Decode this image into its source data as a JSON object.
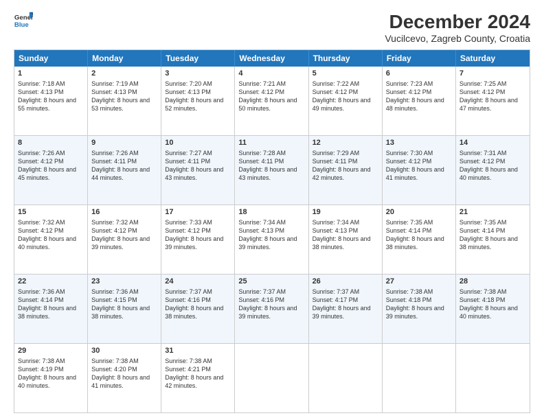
{
  "logo": {
    "line1": "General",
    "line2": "Blue"
  },
  "title": "December 2024",
  "subtitle": "Vucilcevo, Zagreb County, Croatia",
  "weekdays": [
    "Sunday",
    "Monday",
    "Tuesday",
    "Wednesday",
    "Thursday",
    "Friday",
    "Saturday"
  ],
  "weeks": [
    [
      {
        "day": "1",
        "sunrise": "Sunrise: 7:18 AM",
        "sunset": "Sunset: 4:13 PM",
        "daylight": "Daylight: 8 hours and 55 minutes."
      },
      {
        "day": "2",
        "sunrise": "Sunrise: 7:19 AM",
        "sunset": "Sunset: 4:13 PM",
        "daylight": "Daylight: 8 hours and 53 minutes."
      },
      {
        "day": "3",
        "sunrise": "Sunrise: 7:20 AM",
        "sunset": "Sunset: 4:13 PM",
        "daylight": "Daylight: 8 hours and 52 minutes."
      },
      {
        "day": "4",
        "sunrise": "Sunrise: 7:21 AM",
        "sunset": "Sunset: 4:12 PM",
        "daylight": "Daylight: 8 hours and 50 minutes."
      },
      {
        "day": "5",
        "sunrise": "Sunrise: 7:22 AM",
        "sunset": "Sunset: 4:12 PM",
        "daylight": "Daylight: 8 hours and 49 minutes."
      },
      {
        "day": "6",
        "sunrise": "Sunrise: 7:23 AM",
        "sunset": "Sunset: 4:12 PM",
        "daylight": "Daylight: 8 hours and 48 minutes."
      },
      {
        "day": "7",
        "sunrise": "Sunrise: 7:25 AM",
        "sunset": "Sunset: 4:12 PM",
        "daylight": "Daylight: 8 hours and 47 minutes."
      }
    ],
    [
      {
        "day": "8",
        "sunrise": "Sunrise: 7:26 AM",
        "sunset": "Sunset: 4:12 PM",
        "daylight": "Daylight: 8 hours and 45 minutes."
      },
      {
        "day": "9",
        "sunrise": "Sunrise: 7:26 AM",
        "sunset": "Sunset: 4:11 PM",
        "daylight": "Daylight: 8 hours and 44 minutes."
      },
      {
        "day": "10",
        "sunrise": "Sunrise: 7:27 AM",
        "sunset": "Sunset: 4:11 PM",
        "daylight": "Daylight: 8 hours and 43 minutes."
      },
      {
        "day": "11",
        "sunrise": "Sunrise: 7:28 AM",
        "sunset": "Sunset: 4:11 PM",
        "daylight": "Daylight: 8 hours and 43 minutes."
      },
      {
        "day": "12",
        "sunrise": "Sunrise: 7:29 AM",
        "sunset": "Sunset: 4:11 PM",
        "daylight": "Daylight: 8 hours and 42 minutes."
      },
      {
        "day": "13",
        "sunrise": "Sunrise: 7:30 AM",
        "sunset": "Sunset: 4:12 PM",
        "daylight": "Daylight: 8 hours and 41 minutes."
      },
      {
        "day": "14",
        "sunrise": "Sunrise: 7:31 AM",
        "sunset": "Sunset: 4:12 PM",
        "daylight": "Daylight: 8 hours and 40 minutes."
      }
    ],
    [
      {
        "day": "15",
        "sunrise": "Sunrise: 7:32 AM",
        "sunset": "Sunset: 4:12 PM",
        "daylight": "Daylight: 8 hours and 40 minutes."
      },
      {
        "day": "16",
        "sunrise": "Sunrise: 7:32 AM",
        "sunset": "Sunset: 4:12 PM",
        "daylight": "Daylight: 8 hours and 39 minutes."
      },
      {
        "day": "17",
        "sunrise": "Sunrise: 7:33 AM",
        "sunset": "Sunset: 4:12 PM",
        "daylight": "Daylight: 8 hours and 39 minutes."
      },
      {
        "day": "18",
        "sunrise": "Sunrise: 7:34 AM",
        "sunset": "Sunset: 4:13 PM",
        "daylight": "Daylight: 8 hours and 39 minutes."
      },
      {
        "day": "19",
        "sunrise": "Sunrise: 7:34 AM",
        "sunset": "Sunset: 4:13 PM",
        "daylight": "Daylight: 8 hours and 38 minutes."
      },
      {
        "day": "20",
        "sunrise": "Sunrise: 7:35 AM",
        "sunset": "Sunset: 4:14 PM",
        "daylight": "Daylight: 8 hours and 38 minutes."
      },
      {
        "day": "21",
        "sunrise": "Sunrise: 7:35 AM",
        "sunset": "Sunset: 4:14 PM",
        "daylight": "Daylight: 8 hours and 38 minutes."
      }
    ],
    [
      {
        "day": "22",
        "sunrise": "Sunrise: 7:36 AM",
        "sunset": "Sunset: 4:14 PM",
        "daylight": "Daylight: 8 hours and 38 minutes."
      },
      {
        "day": "23",
        "sunrise": "Sunrise: 7:36 AM",
        "sunset": "Sunset: 4:15 PM",
        "daylight": "Daylight: 8 hours and 38 minutes."
      },
      {
        "day": "24",
        "sunrise": "Sunrise: 7:37 AM",
        "sunset": "Sunset: 4:16 PM",
        "daylight": "Daylight: 8 hours and 38 minutes."
      },
      {
        "day": "25",
        "sunrise": "Sunrise: 7:37 AM",
        "sunset": "Sunset: 4:16 PM",
        "daylight": "Daylight: 8 hours and 39 minutes."
      },
      {
        "day": "26",
        "sunrise": "Sunrise: 7:37 AM",
        "sunset": "Sunset: 4:17 PM",
        "daylight": "Daylight: 8 hours and 39 minutes."
      },
      {
        "day": "27",
        "sunrise": "Sunrise: 7:38 AM",
        "sunset": "Sunset: 4:18 PM",
        "daylight": "Daylight: 8 hours and 39 minutes."
      },
      {
        "day": "28",
        "sunrise": "Sunrise: 7:38 AM",
        "sunset": "Sunset: 4:18 PM",
        "daylight": "Daylight: 8 hours and 40 minutes."
      }
    ],
    [
      {
        "day": "29",
        "sunrise": "Sunrise: 7:38 AM",
        "sunset": "Sunset: 4:19 PM",
        "daylight": "Daylight: 8 hours and 40 minutes."
      },
      {
        "day": "30",
        "sunrise": "Sunrise: 7:38 AM",
        "sunset": "Sunset: 4:20 PM",
        "daylight": "Daylight: 8 hours and 41 minutes."
      },
      {
        "day": "31",
        "sunrise": "Sunrise: 7:38 AM",
        "sunset": "Sunset: 4:21 PM",
        "daylight": "Daylight: 8 hours and 42 minutes."
      },
      {
        "day": "",
        "sunrise": "",
        "sunset": "",
        "daylight": ""
      },
      {
        "day": "",
        "sunrise": "",
        "sunset": "",
        "daylight": ""
      },
      {
        "day": "",
        "sunrise": "",
        "sunset": "",
        "daylight": ""
      },
      {
        "day": "",
        "sunrise": "",
        "sunset": "",
        "daylight": ""
      }
    ]
  ]
}
